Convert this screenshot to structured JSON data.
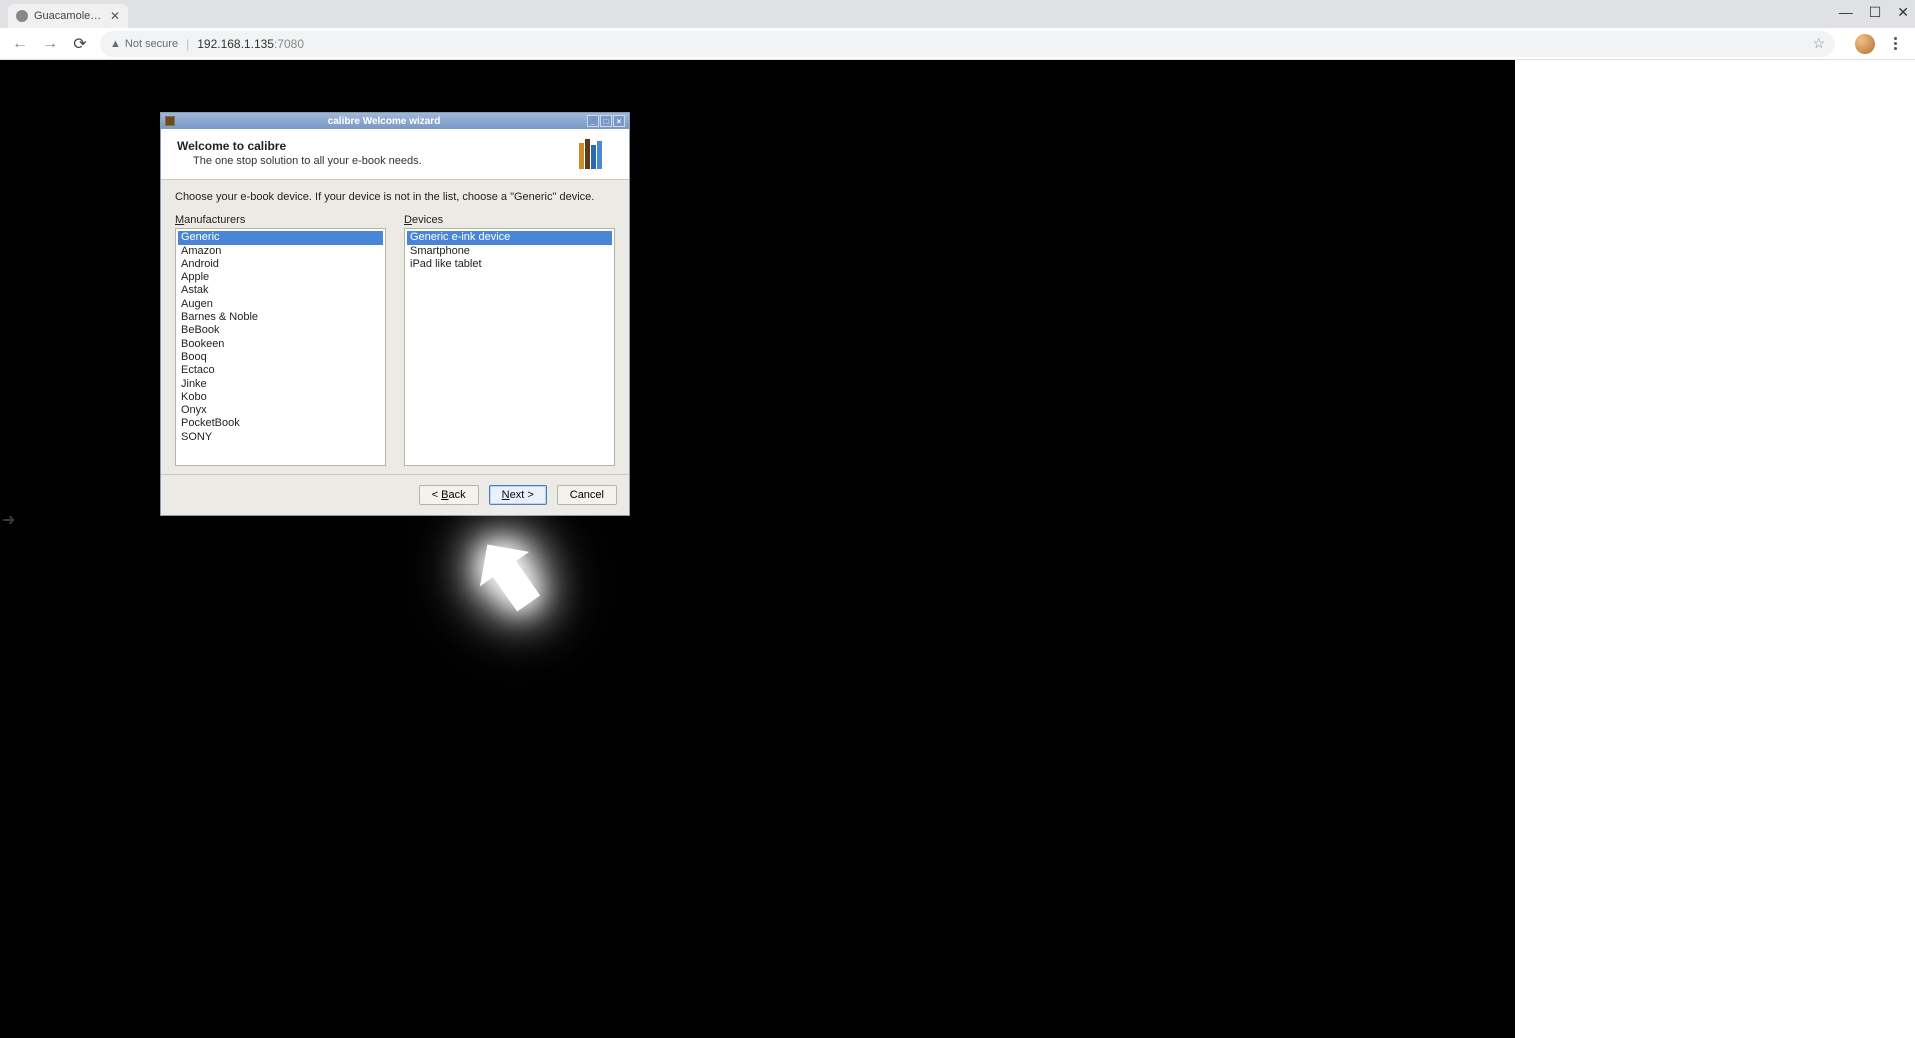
{
  "browser": {
    "tab_title": "Guacamole Clie",
    "security_label": "Not secure",
    "url_host": "192.168.1.135",
    "url_port": ":7080"
  },
  "wizard": {
    "window_title": "calibre Welcome wizard",
    "heading": "Welcome to calibre",
    "subheading": "The one stop solution to all your e-book needs.",
    "instruction": "Choose your e-book device. If your device is not in the list, choose a \"Generic\" device.",
    "manufacturers_label_pre": "M",
    "manufacturers_label_rest": "anufacturers",
    "devices_label_pre": "D",
    "devices_label_rest": "evices",
    "manufacturers": [
      "Generic",
      "Amazon",
      "Android",
      "Apple",
      "Astak",
      "Augen",
      "Barnes & Noble",
      "BeBook",
      "Bookeen",
      "Booq",
      "Ectaco",
      "Jinke",
      "Kobo",
      "Onyx",
      "PocketBook",
      "SONY"
    ],
    "manufacturers_selected": 0,
    "devices": [
      "Generic e-ink device",
      "Smartphone",
      "iPad like tablet"
    ],
    "devices_selected": 0,
    "back_pre": "< ",
    "back_mn": "B",
    "back_rest": "ack",
    "next_mn": "N",
    "next_rest": "ext >",
    "cancel": "Cancel"
  }
}
